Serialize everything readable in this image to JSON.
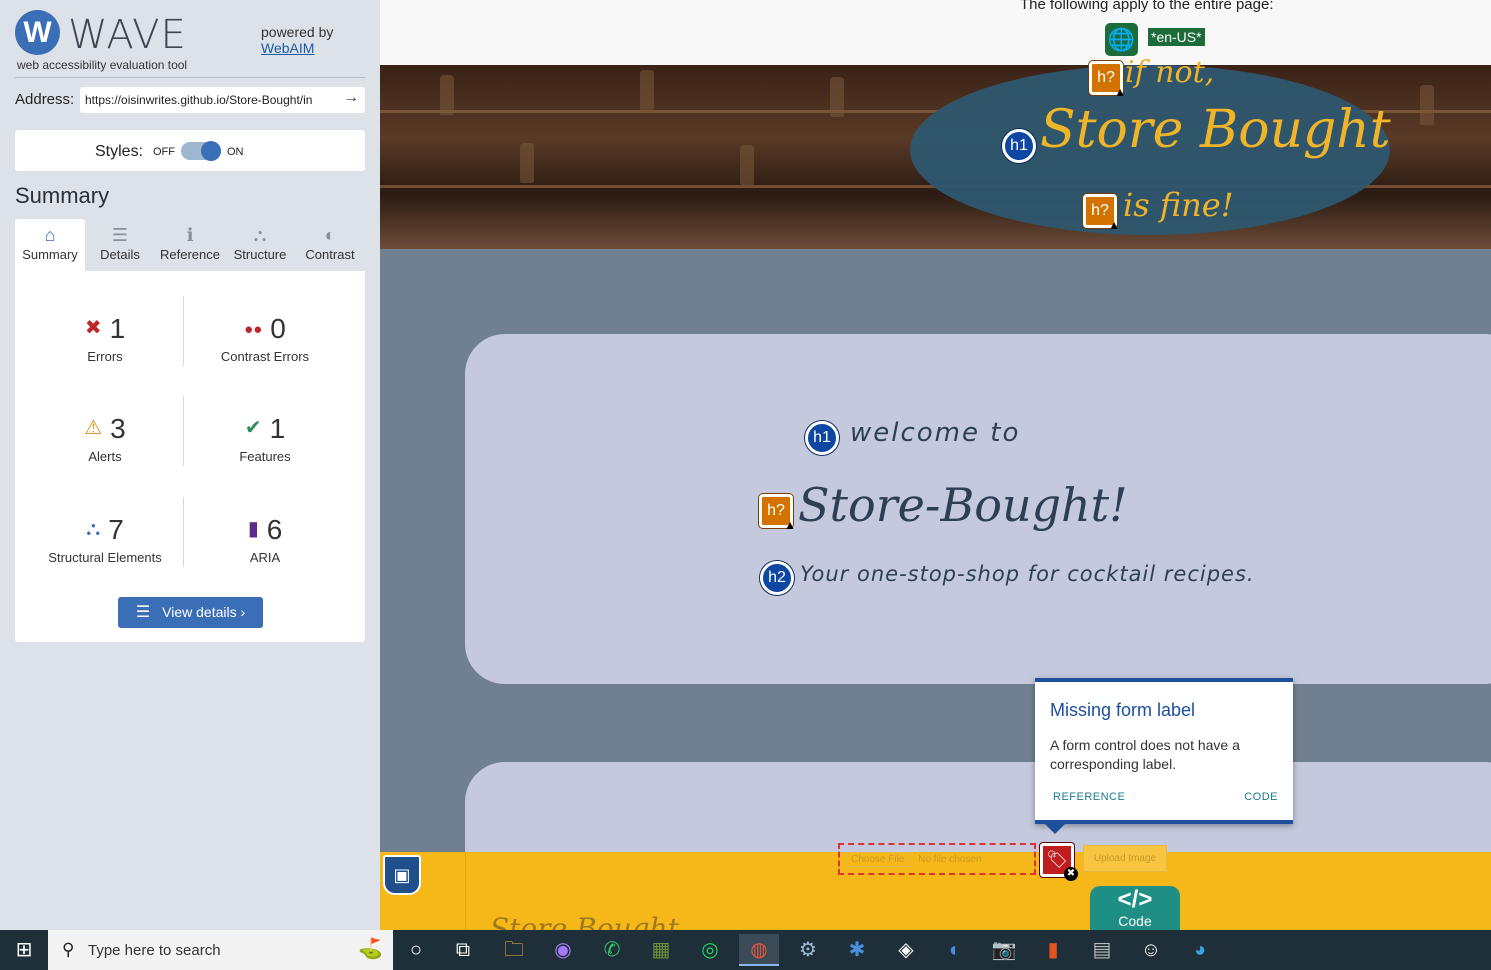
{
  "wave": {
    "logo_letter": "W",
    "logo_word": "WAVE",
    "logo_sub": "web accessibility evaluation tool",
    "powered_by": "powered by",
    "webaim_link": "WebAIM",
    "address_label": "Address:",
    "address_value": "https://oisinwrites.github.io/Store-Bought/in",
    "address_go": "→",
    "styles_label": "Styles:",
    "styles_off": "OFF",
    "styles_on": "ON",
    "styles_enabled": true,
    "summary_heading": "Summary",
    "tabs": [
      {
        "label": "Summary",
        "icon": "home-icon",
        "glyph": "⌂"
      },
      {
        "label": "Details",
        "icon": "list-icon",
        "glyph": "☰"
      },
      {
        "label": "Reference",
        "icon": "info-icon",
        "glyph": "ℹ"
      },
      {
        "label": "Structure",
        "icon": "structure-icon",
        "glyph": "⛬"
      },
      {
        "label": "Contrast",
        "icon": "contrast-icon",
        "glyph": "◐"
      }
    ],
    "active_tab": "Summary",
    "stats": {
      "errors": {
        "count": "1",
        "label": "Errors",
        "glyph": "✖",
        "color": "#c0272d"
      },
      "contrast_errors": {
        "count": "0",
        "label": "Contrast Errors",
        "glyph": "●●",
        "color": "#c0272d"
      },
      "alerts": {
        "count": "3",
        "label": "Alerts",
        "glyph": "⚠",
        "color": "#e0901c"
      },
      "features": {
        "count": "1",
        "label": "Features",
        "glyph": "✔",
        "color": "#2e8b57"
      },
      "structural": {
        "count": "7",
        "label": "Structural Elements",
        "glyph": "⛬",
        "color": "#3a6eb6"
      },
      "aria": {
        "count": "6",
        "label": "ARIA",
        "glyph": "▮",
        "color": "#5b2d8a"
      }
    },
    "view_details": "View details ›"
  },
  "preview": {
    "lang_notice": "The following apply to the entire page:",
    "lang_tag": "*en-US*",
    "hero_line1": "if not,",
    "hero_title": "Store Bought",
    "hero_line3": "is fine!",
    "badges": {
      "h1": "h1",
      "h2": "h2",
      "h_unknown": "h?",
      "warn": "▲"
    },
    "welcome": "welcome to",
    "big_title": "Store-Bought!",
    "tagline": "Your one-stop-shop for cocktail recipes.",
    "file_choose": "Choose File",
    "file_none": "No file chosen",
    "upload_label": "Upload Image",
    "footer_script": "Store Bought",
    "code_symbol": "</>",
    "code_label": "Code",
    "popup": {
      "title": "Missing form label",
      "body": "A form control does not have a corresponding label.",
      "reference": "REFERENCE",
      "code": "CODE"
    }
  },
  "taskbar": {
    "search_placeholder": "Type here to search",
    "apps": [
      "cortana",
      "task-view",
      "file-explorer",
      "messenger",
      "whatsapp",
      "minecraft",
      "spotify",
      "chrome",
      "steam",
      "bluetooth-app",
      "obs",
      "zoom",
      "camera",
      "office",
      "calculator",
      "emoji-app",
      "edge"
    ],
    "chrome_badge": "0"
  }
}
